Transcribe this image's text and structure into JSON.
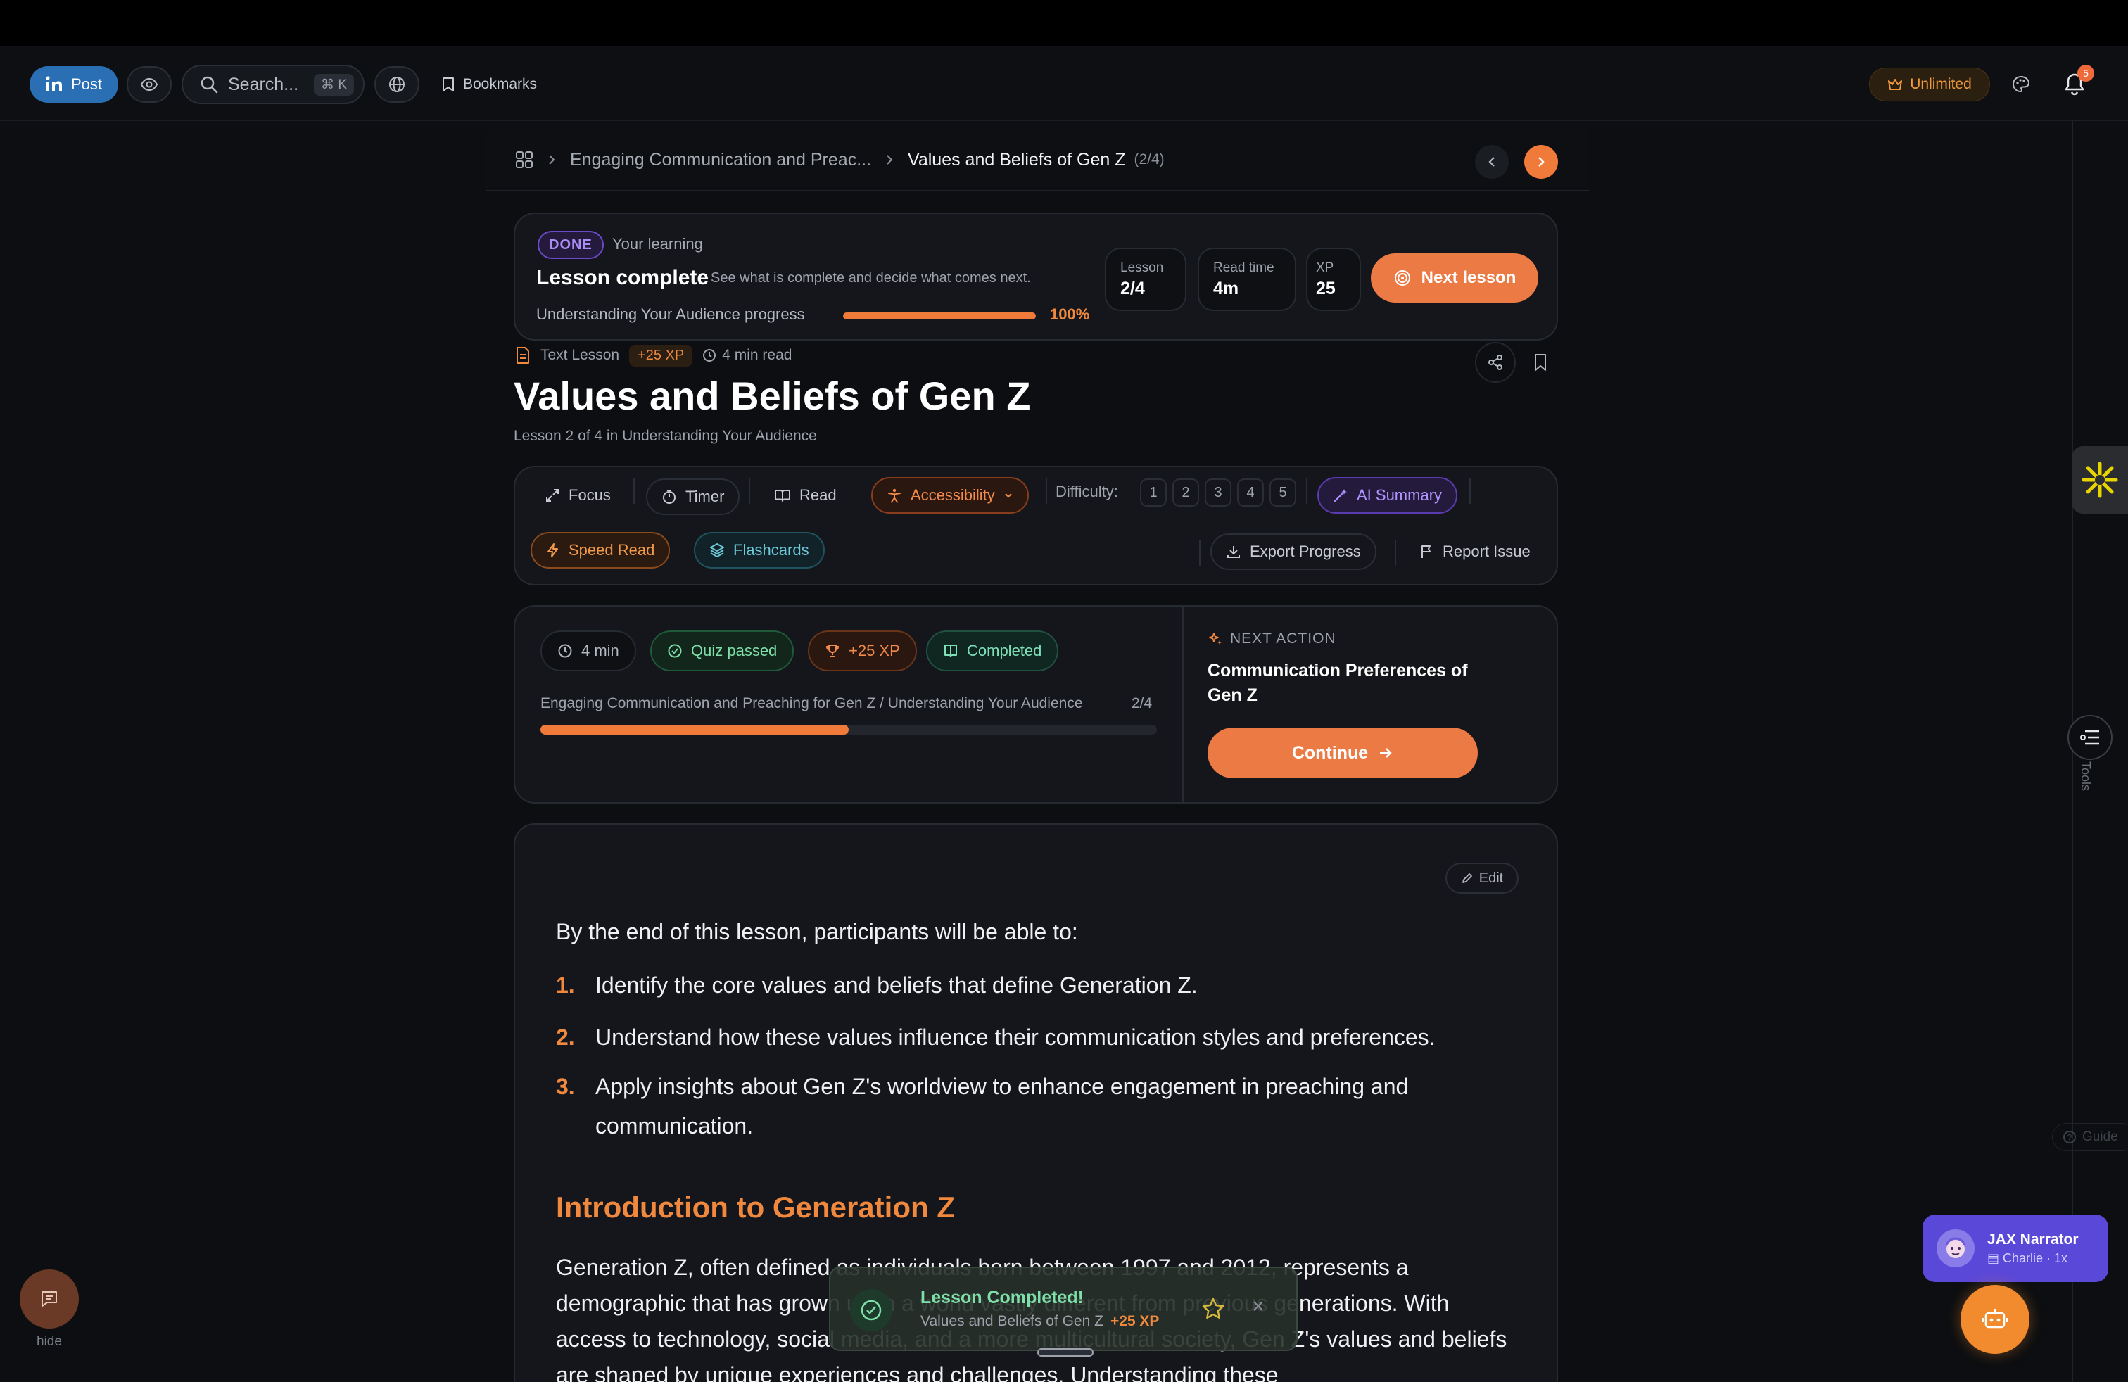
{
  "header": {
    "post_label": "Post",
    "search_placeholder": "Search...",
    "search_shortcut": "⌘ K",
    "bookmarks_label": "Bookmarks",
    "unlimited_label": "Unlimited",
    "notifications_count": "5"
  },
  "breadcrumb": {
    "course": "Engaging Communication and Preac...",
    "current": "Values and Beliefs of Gen Z",
    "count": "(2/4)"
  },
  "status_card": {
    "badge": "DONE",
    "kicker": "Your learning",
    "title": "Lesson complete",
    "subtitle": "See what is complete and decide what comes next.",
    "progress_label": "Understanding Your Audience progress",
    "progress_value": 1.0,
    "progress_text": "100%",
    "stats": [
      {
        "label": "Lesson",
        "value": "2/4"
      },
      {
        "label": "Read time",
        "value": "4m"
      },
      {
        "label": "XP",
        "value": "25"
      }
    ],
    "next_lesson_label": "Next lesson"
  },
  "lesson": {
    "type": "Text Lesson",
    "xp": "+25 XP",
    "read_time": "4 min read",
    "title": "Values and Beliefs of Gen Z",
    "subtitle": "Lesson 2 of 4 in Understanding Your Audience"
  },
  "toolbar": {
    "focus": "Focus",
    "timer": "Timer",
    "read": "Read",
    "accessibility": "Accessibility",
    "difficulty_label": "Difficulty:",
    "difficulty_levels": [
      "1",
      "2",
      "3",
      "4",
      "5"
    ],
    "ai_summary": "AI Summary",
    "speed_read": "Speed Read",
    "flashcards": "Flashcards",
    "export_progress": "Export Progress",
    "report_issue": "Report Issue"
  },
  "progress_card": {
    "chips": {
      "time": "4 min",
      "quiz": "Quiz passed",
      "xp": "+25 XP",
      "completed": "Completed"
    },
    "path": "Engaging Communication and Preaching for Gen Z / Understanding Your Audience",
    "count": "2/4",
    "progress_value": 0.5,
    "next_action_label": "NEXT ACTION",
    "next_action_title": "Communication Preferences of Gen Z",
    "continue_label": "Continue"
  },
  "content": {
    "edit_label": "Edit",
    "intro": "By the end of this lesson, participants will be able to:",
    "objectives": [
      {
        "num": "1.",
        "text": "Identify the core values and beliefs that define Generation Z."
      },
      {
        "num": "2.",
        "text": "Understand how these values influence their communication styles and preferences."
      },
      {
        "num": "3.",
        "text": "Apply insights about Gen Z's worldview to enhance engagement in preaching and communication."
      }
    ],
    "section_title": "Introduction to Generation Z",
    "paragraph": "Generation Z, often defined as individuals born between 1997 and 2012, represents a demographic that has grown up in a world vastly different from previous generations. With access to technology, social media, and a more multicultural society, Gen Z's values and beliefs are shaped by unique experiences and challenges. Understanding these"
  },
  "toast": {
    "title": "Lesson Completed!",
    "subtitle": "Values and Beliefs of Gen Z",
    "xp": "+25 XP"
  },
  "side": {
    "tools_label": "Tools",
    "guide_label": "Guide",
    "hide_label": "hide"
  },
  "narrator": {
    "name": "JAX Narrator",
    "voice": "Charlie · 1x"
  },
  "colors": {
    "accent": "#ec7a44",
    "background": "#0c0e11",
    "card": "#14161b",
    "success": "#7ee0a8",
    "purple": "#5a48d8"
  }
}
